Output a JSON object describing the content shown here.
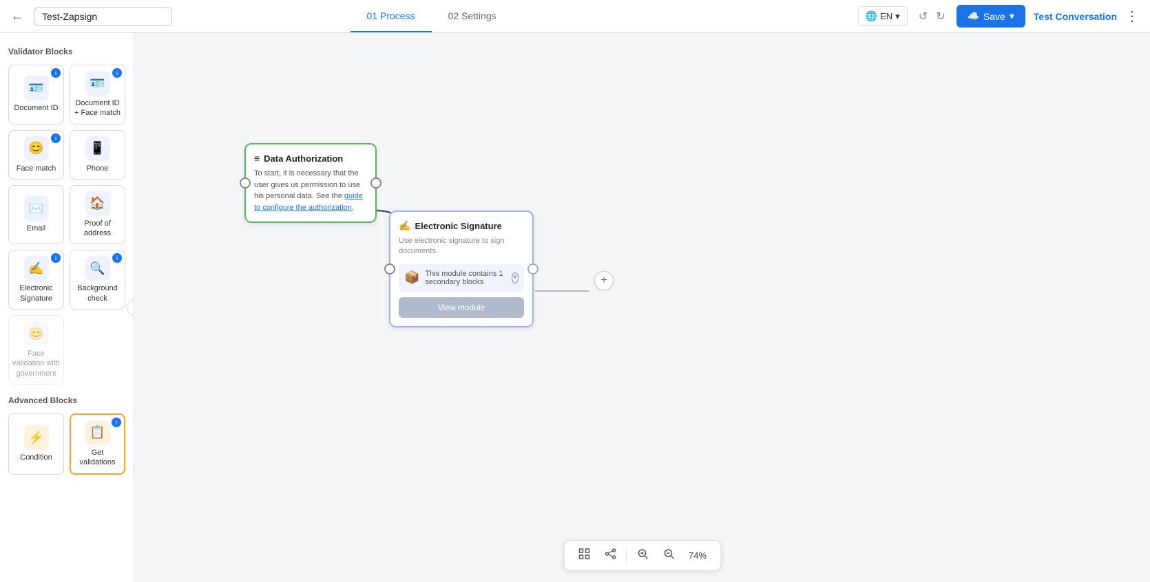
{
  "header": {
    "back_label": "←",
    "title": "Test-Zapsign",
    "tabs": [
      {
        "id": "process",
        "label": "01 Process",
        "active": true
      },
      {
        "id": "settings",
        "label": "02 Settings",
        "active": false
      }
    ],
    "language": "EN",
    "undo_label": "↺",
    "redo_label": "↻",
    "save_label": "Save",
    "save_chevron": "▾",
    "test_conversation_label": "Test Conversation",
    "more_label": "⋮"
  },
  "sidebar": {
    "validator_section_title": "Validator Blocks",
    "advanced_section_title": "Advanced Blocks",
    "collapse_icon": "‹",
    "blocks": [
      {
        "id": "document-id",
        "label": "Document ID",
        "icon": "🪪",
        "disabled": false,
        "info": true
      },
      {
        "id": "document-id-face",
        "label": "Document ID + Face match",
        "icon": "🪪",
        "disabled": false,
        "info": true
      },
      {
        "id": "face-match",
        "label": "Face match",
        "icon": "😊",
        "disabled": false,
        "info": true
      },
      {
        "id": "phone",
        "label": "Phone",
        "icon": "📱",
        "disabled": false,
        "info": false
      },
      {
        "id": "email",
        "label": "Email",
        "icon": "✉️",
        "disabled": false,
        "info": false
      },
      {
        "id": "proof-of-address",
        "label": "Proof of address",
        "icon": "🏠",
        "disabled": false,
        "info": false
      },
      {
        "id": "electronic-signature-block",
        "label": "Electronic Signature",
        "icon": "✍️",
        "disabled": false,
        "info": true
      },
      {
        "id": "background-check",
        "label": "Background check",
        "icon": "🔍",
        "disabled": false,
        "info": true
      },
      {
        "id": "face-validation-gov",
        "label": "Face validation with government",
        "icon": "😊",
        "disabled": true,
        "info": false
      }
    ],
    "advanced_blocks": [
      {
        "id": "condition",
        "label": "Condition",
        "icon": "⚡",
        "disabled": false,
        "info": false
      },
      {
        "id": "get-validations",
        "label": "Get validations",
        "icon": "📋",
        "disabled": false,
        "info": true,
        "highlighted": true
      }
    ]
  },
  "canvas": {
    "nodes": {
      "data_authorization": {
        "title": "Data Authorization",
        "icon": "≡",
        "body": "To start, it is necessary that the user gives us permission to use his personal data. See the guide to configure the authorization.",
        "link_text": "guide to configure the authorization"
      },
      "electronic_signature": {
        "title": "Electronic Signature",
        "icon": "✍️",
        "subtitle": "Use electronic signature to sign documents.",
        "secondary_blocks_label": "This module contains 1 secondary blocks",
        "view_module_label": "View module"
      }
    },
    "toolbar": {
      "fit_icon": "⊞",
      "share_icon": "⋯",
      "zoom_in_icon": "+",
      "zoom_out_icon": "−",
      "zoom_level": "74%"
    }
  }
}
